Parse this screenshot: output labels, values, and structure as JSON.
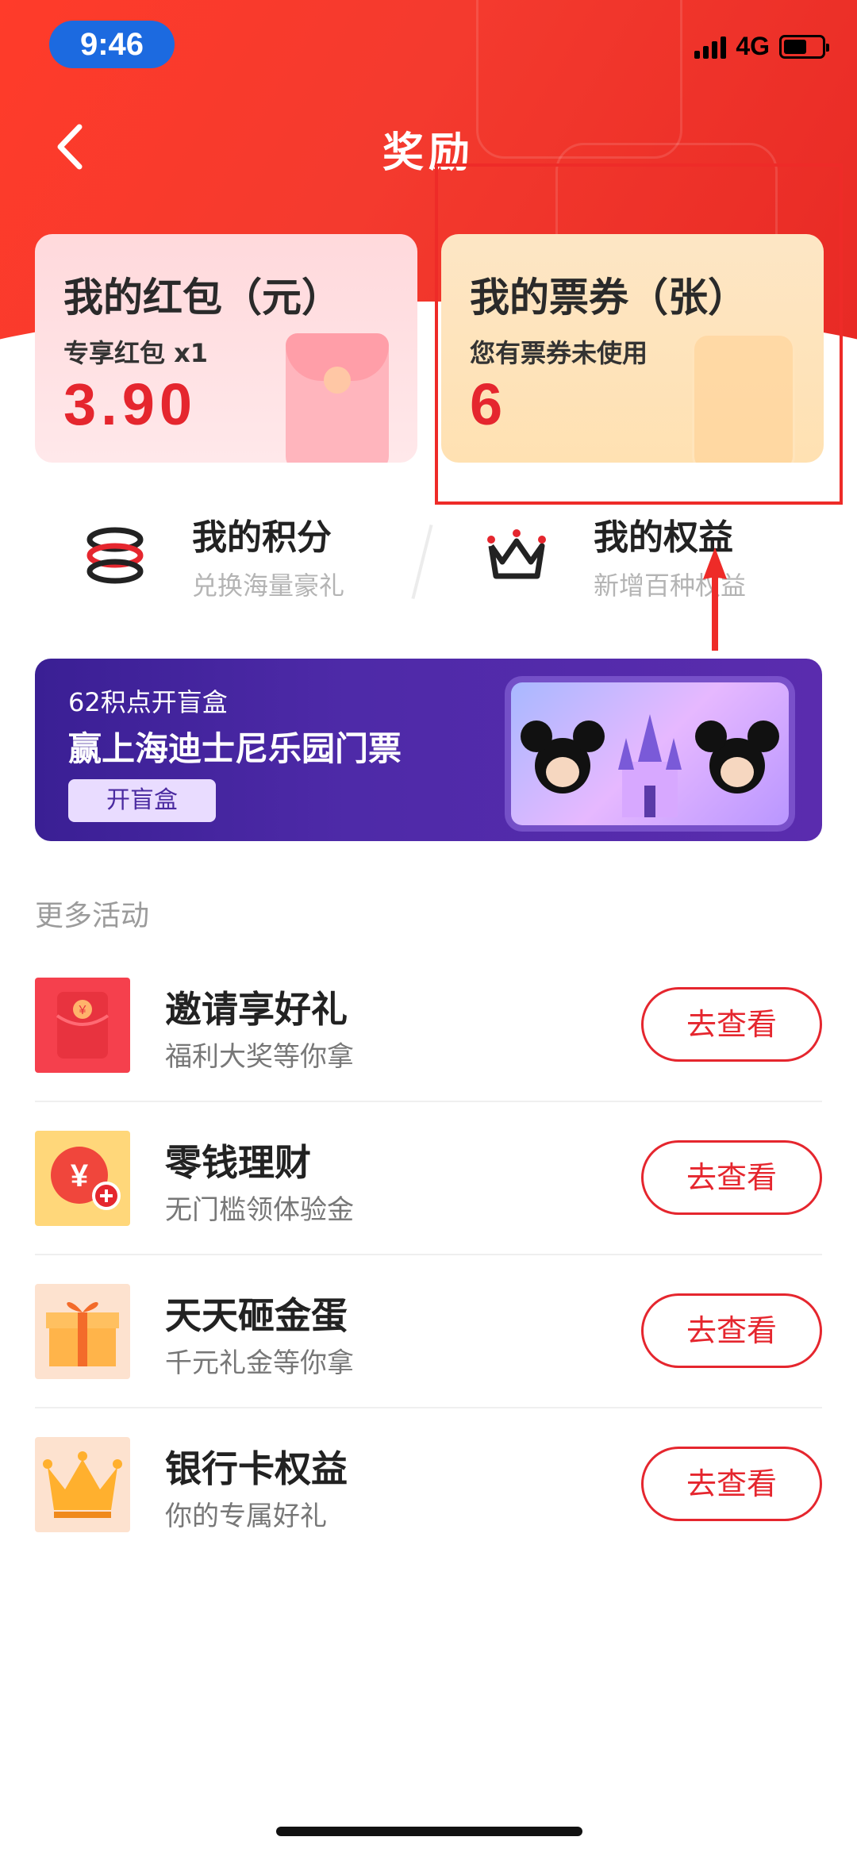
{
  "status_bar": {
    "time": "9:46",
    "network": "4G",
    "battery_level": 0.6
  },
  "nav": {
    "title": "奖励"
  },
  "cards": {
    "red_packet": {
      "title": "我的红包（元）",
      "subtitle": "专享红包 x1",
      "value": "3.90"
    },
    "ticket": {
      "title": "我的票券（张）",
      "subtitle": "您有票券未使用",
      "value": "6"
    }
  },
  "quick_links": {
    "points": {
      "title": "我的积分",
      "subtitle": "兑换海量豪礼"
    },
    "rights": {
      "title": "我的权益",
      "subtitle": "新增百种权益"
    }
  },
  "banner": {
    "tag": "62积点开盲盒",
    "title": "赢上海迪士尼乐园门票",
    "button": "开盲盒"
  },
  "section": {
    "title": "更多活动"
  },
  "activities": [
    {
      "title": "邀请享好礼",
      "subtitle": "福利大奖等你拿",
      "button": "去查看",
      "icon": "red-envelope-icon"
    },
    {
      "title": "零钱理财",
      "subtitle": "无门槛领体验金",
      "button": "去查看",
      "icon": "yuan-coin-icon"
    },
    {
      "title": "天天砸金蛋",
      "subtitle": "千元礼金等你拿",
      "button": "去查看",
      "icon": "gift-box-icon"
    },
    {
      "title": "银行卡权益",
      "subtitle": "你的专属好礼",
      "button": "去查看",
      "icon": "crown-icon"
    }
  ],
  "colors": {
    "brand_red": "#e5262e",
    "header_red": "#f43a2e",
    "banner_purple": "#4e2aa8"
  }
}
